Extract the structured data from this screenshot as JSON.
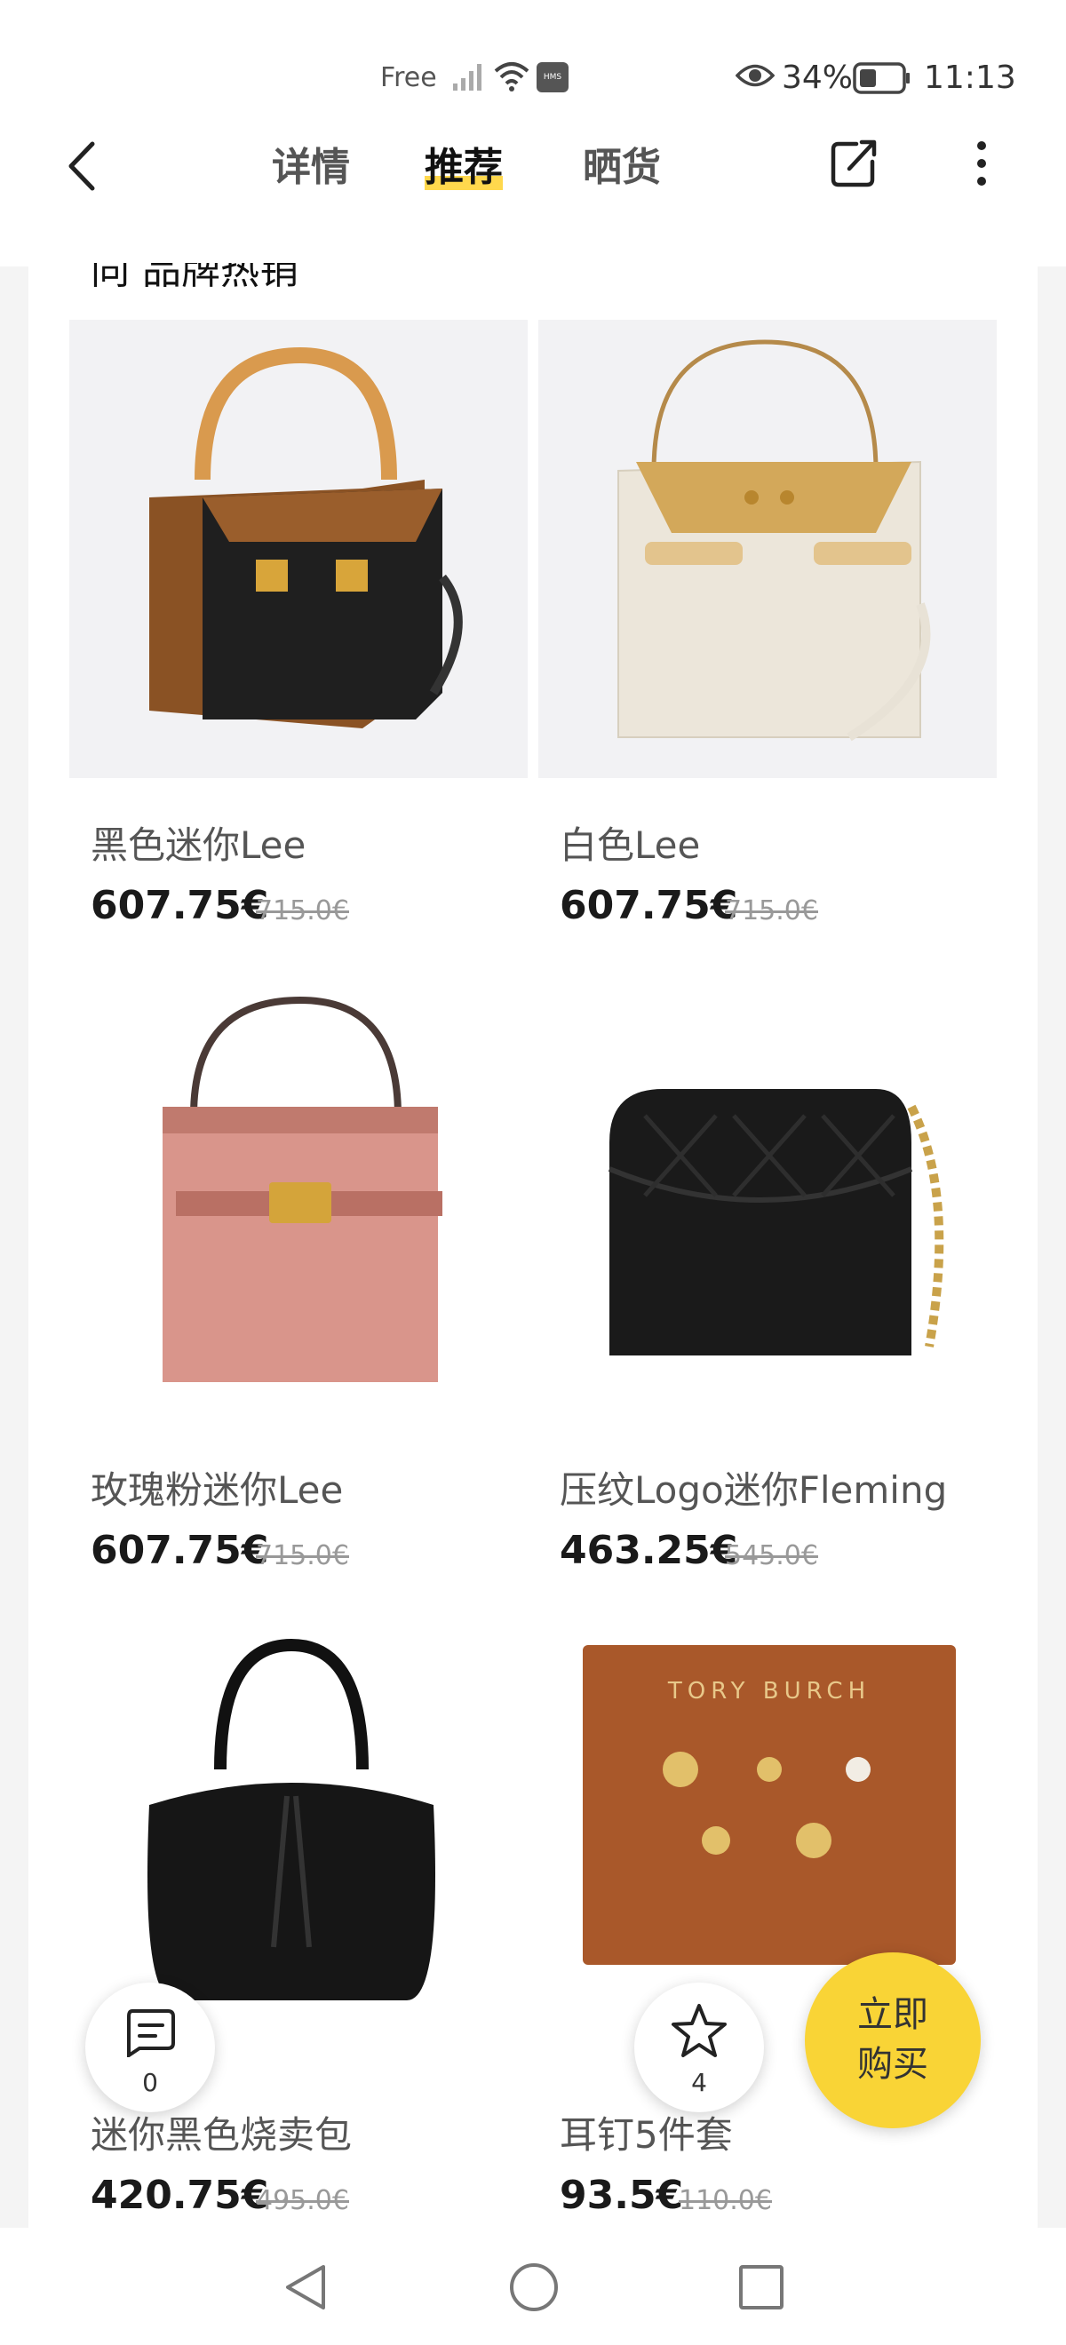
{
  "status_bar": {
    "carrier": "Free",
    "battery_percent": "34%",
    "time": "11:13",
    "icons": [
      "signal-icon",
      "wifi-icon",
      "hms-icon",
      "eye-icon",
      "battery-icon"
    ]
  },
  "header": {
    "tabs": [
      {
        "label": "详情",
        "active": false
      },
      {
        "label": "推荐",
        "active": true
      },
      {
        "label": "晒货",
        "active": false
      }
    ],
    "icons": [
      "back-arrow-icon",
      "share-icon",
      "more-icon"
    ]
  },
  "content": {
    "partial_heading": "同 品牌热销",
    "products": [
      {
        "name": "黑色迷你Lee",
        "price": "607.75€",
        "original_price": "715.0€"
      },
      {
        "name": "白色Lee",
        "price": "607.75€",
        "original_price": "715.0€"
      },
      {
        "name": "玫瑰粉迷你Lee",
        "price": "607.75€",
        "original_price": "715.0€"
      },
      {
        "name": "压纹Logo迷你Fleming",
        "price": "463.25€",
        "original_price": "545.0€"
      },
      {
        "name": "迷你黑色烧卖包",
        "price": "420.75€",
        "original_price": "495.0€"
      },
      {
        "name": "耳钉5件套",
        "price": "93.5€",
        "original_price": "110.0€"
      }
    ],
    "earring_card_brand": "TORY BURCH"
  },
  "floating": {
    "comments_count": "0",
    "favorites_count": "4",
    "buy_line1": "立即",
    "buy_line2": "购买"
  },
  "nav_bar": {
    "icons": [
      "nav-back-icon",
      "nav-home-icon",
      "nav-recent-icon"
    ]
  },
  "colors": {
    "accent": "#f9d436",
    "tab_highlight": "#ffd84d",
    "background": "#f4f4f4"
  }
}
